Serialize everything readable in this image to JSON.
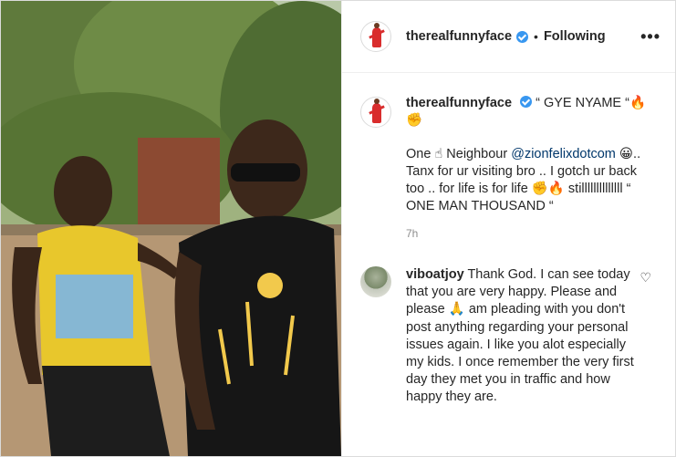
{
  "header": {
    "username": "therealfunnyface",
    "separator": "•",
    "follow_status": "Following",
    "more_label": "•••"
  },
  "caption": {
    "username": "therealfunnyface",
    "line1": "“ GYE NYAME “🔥 ✊",
    "line2_pre": "One ☝ Neighbour ",
    "mention": "@zionfelixdotcom",
    "line2_post": " 😀.. Tanx for ur visiting bro .. I gotch ur back too .. for life is for life ✊🔥 stillllllllllllll “ ONE MAN THOUSAND “",
    "time": "7h"
  },
  "comment": {
    "username": "viboatjoy",
    "text": "Thank God. I can see today that you are very happy. Please and please 🙏 am pleading with you don't post anything regarding your personal issues again. I like you alot especially my kids. I once remember the very first day they met you in traffic and how happy they are."
  }
}
